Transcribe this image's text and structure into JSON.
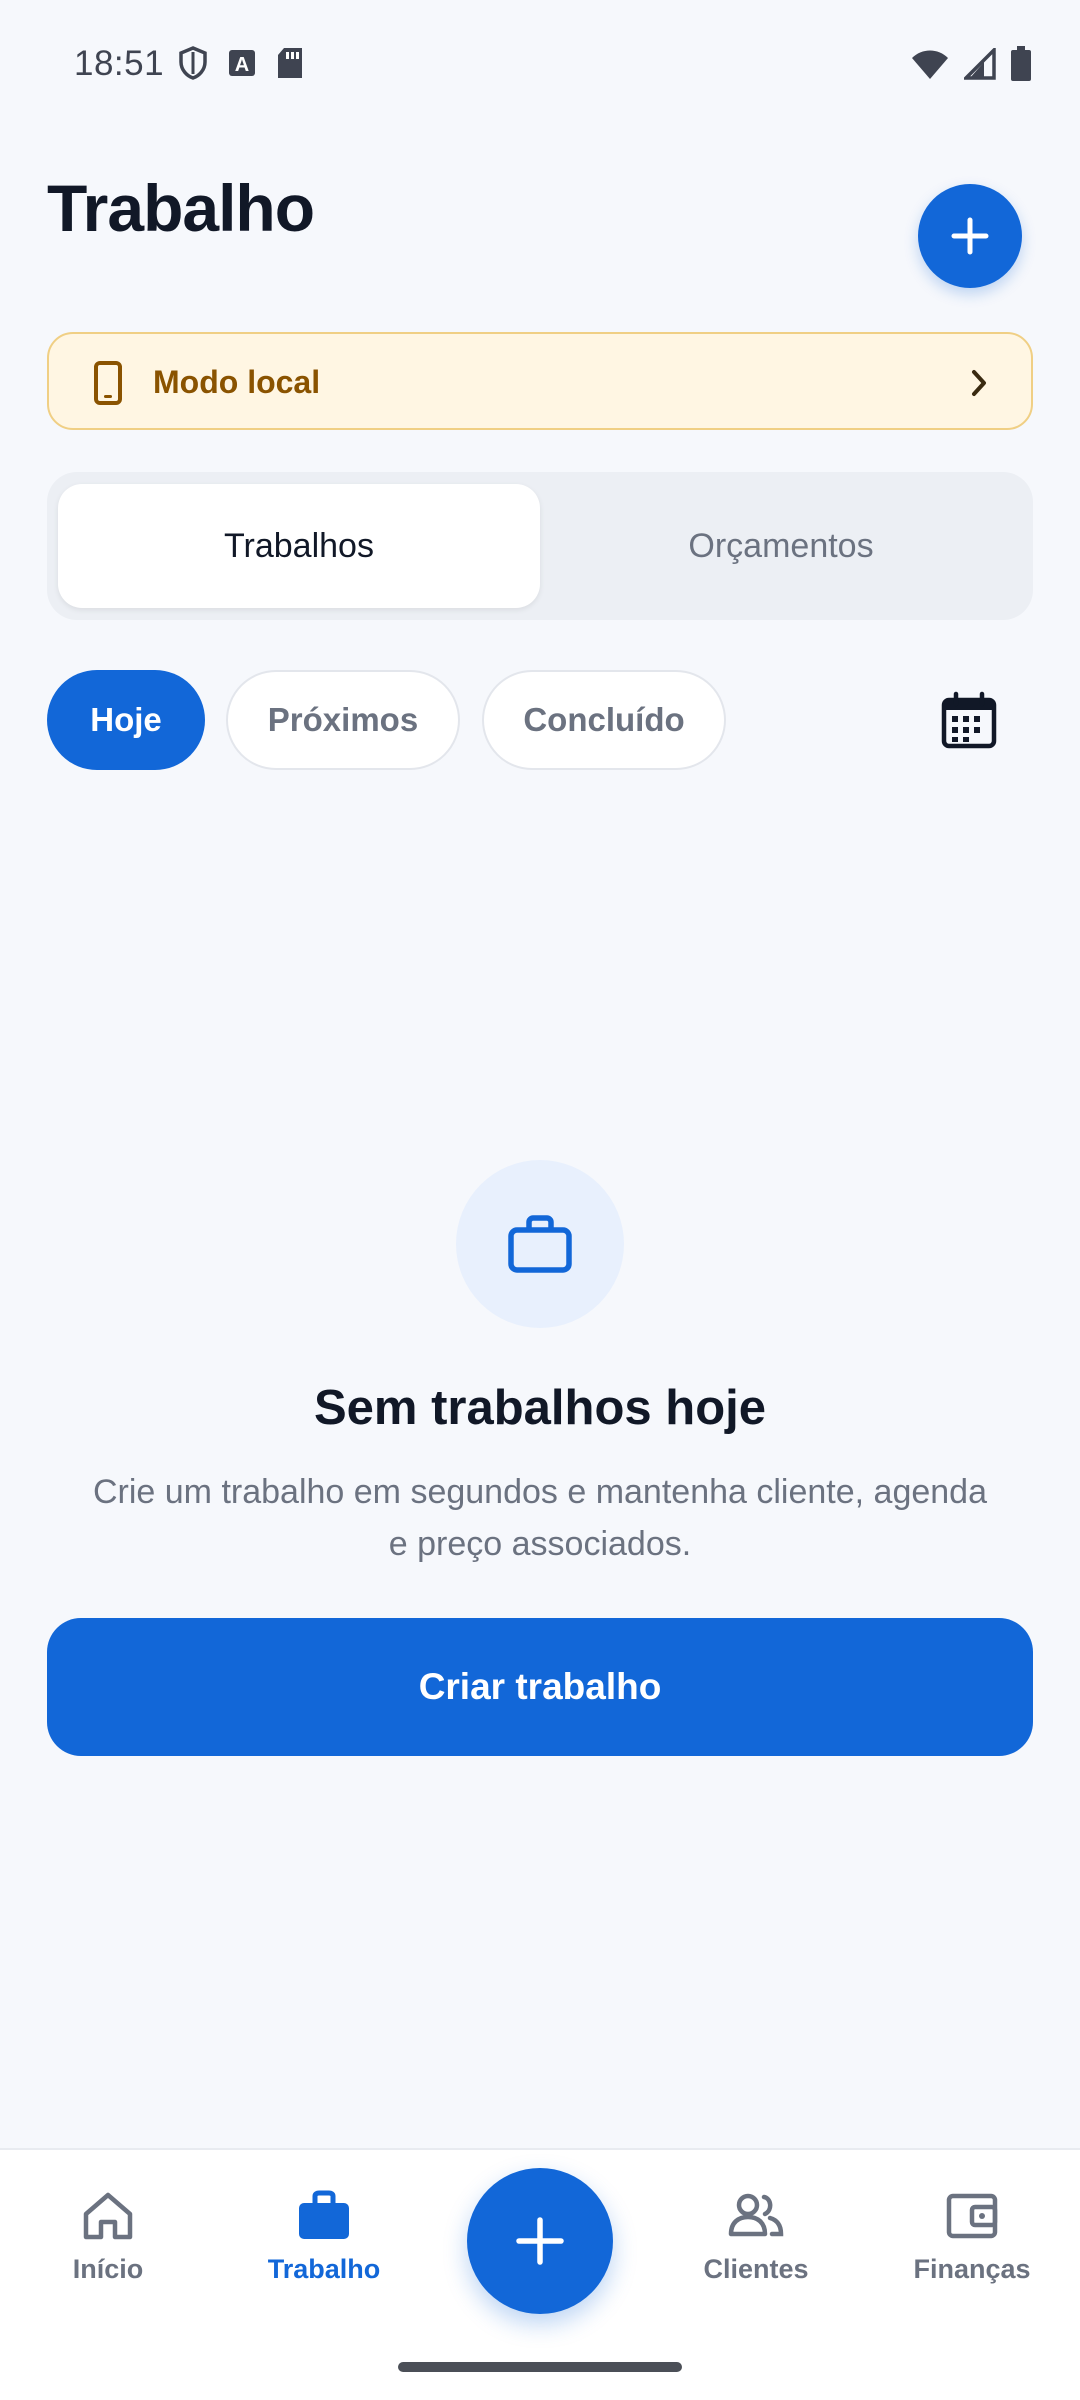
{
  "status_bar": {
    "time": "18:51",
    "icons_left": [
      "shield-icon",
      "font-a-icon",
      "sd-card-icon"
    ],
    "icons_right": [
      "wifi-icon",
      "signal-icon",
      "battery-icon"
    ]
  },
  "header": {
    "title": "Trabalho",
    "add_button_icon": "plus-icon"
  },
  "banner": {
    "label": "Modo local",
    "icon": "phone-icon",
    "trailing_icon": "chevron-right-icon"
  },
  "segments": [
    {
      "label": "Trabalhos",
      "active": true
    },
    {
      "label": "Orçamentos",
      "active": false
    }
  ],
  "filters": [
    {
      "label": "Hoje",
      "active": true
    },
    {
      "label": "Próximos",
      "active": false
    },
    {
      "label": "Concluído",
      "active": false
    }
  ],
  "calendar_icon": "calendar-icon",
  "empty_state": {
    "icon": "briefcase-icon",
    "title": "Sem trabalhos hoje",
    "description": "Crie um trabalho em segundos e mantenha cliente, agenda e preço associados.",
    "button_label": "Criar trabalho"
  },
  "bottom_nav": {
    "items": [
      {
        "label": "Início",
        "icon": "home-icon",
        "active": false
      },
      {
        "label": "Trabalho",
        "icon": "briefcase-icon",
        "active": true
      },
      {
        "label": "Clientes",
        "icon": "people-icon",
        "active": false
      },
      {
        "label": "Finanças",
        "icon": "wallet-icon",
        "active": false
      }
    ],
    "fab_icon": "plus-icon"
  },
  "colors": {
    "primary": "#1267d8",
    "background": "#f6f8fc",
    "banner_bg": "#fff6e3",
    "banner_text": "#8a5300",
    "muted_text": "#6b7280",
    "heading_text": "#111827"
  }
}
